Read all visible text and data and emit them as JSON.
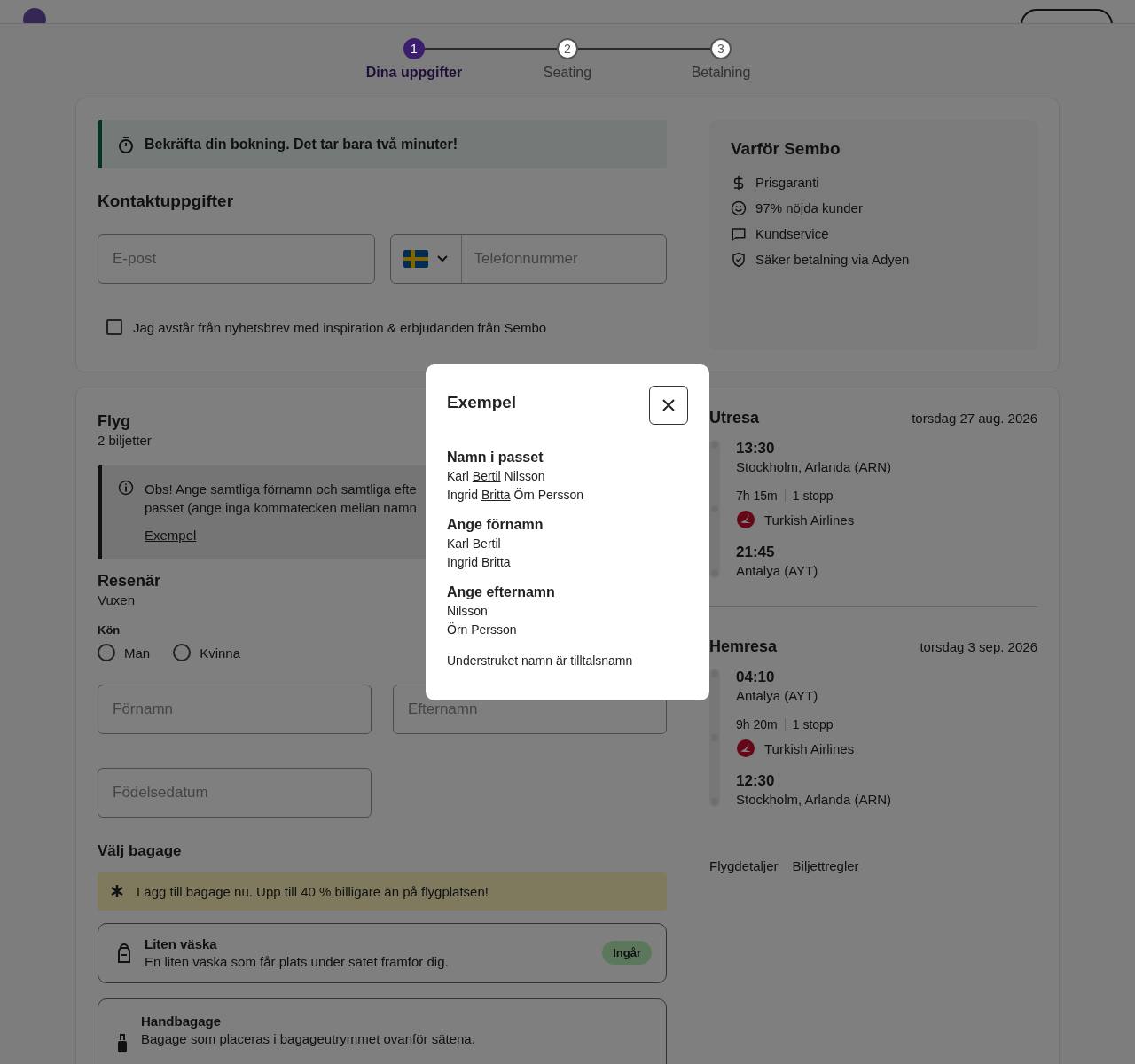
{
  "steps": [
    {
      "number": "1",
      "label": "Dina uppgifter",
      "selected": true
    },
    {
      "number": "2",
      "label": "Seating",
      "selected": false
    },
    {
      "number": "3",
      "label": "Betalning",
      "selected": false
    }
  ],
  "banner": {
    "text": "Bekräfta din bokning. Det tar bara två minuter!"
  },
  "contact": {
    "title": "Kontaktuppgifter",
    "email_placeholder": "E-post",
    "phone_placeholder": "Telefonnummer",
    "newsletter": {
      "label": "Jag avstår från nyhetsbrev med inspiration & erbjudanden från Sembo",
      "checked": false
    }
  },
  "why": {
    "title": "Varför Sembo",
    "items": [
      {
        "kind": "price",
        "text": "Prisgaranti"
      },
      {
        "kind": "smile",
        "text": "97% nöjda kunder"
      },
      {
        "kind": "chat",
        "text": "Kundservice"
      },
      {
        "kind": "shield",
        "text": "Säker betalning via Adyen"
      }
    ]
  },
  "flight": {
    "title": "Flyg",
    "subtitle": "2 biljetter",
    "notice": {
      "lines": [
        "Obs! Ange samtliga förnamn och samtliga efte",
        "passet (ange inga kommatecken mellan namn"
      ],
      "link": "Exempel"
    },
    "traveler": {
      "title": "Resenär",
      "subtitle": "Vuxen",
      "gender_label": "Kön",
      "options": [
        {
          "label": "Man",
          "selected": false
        },
        {
          "label": "Kvinna",
          "selected": false
        }
      ]
    },
    "first_name_placeholder": "Förnamn",
    "last_name_placeholder": "Efternamn",
    "birth_placeholder": "Födelsedatum",
    "baggage": {
      "title": "Välj bagage",
      "promo": "Lägg till bagage nu. Upp till 40 % billigare än på flygplatsen!",
      "items": [
        {
          "kind": "small",
          "title": "Liten väska",
          "description": "En liten väska som får plats under sätet framför dig.",
          "badge": "Ingår"
        },
        {
          "kind": "cabin",
          "title": "Handbagage",
          "description": "Bagage som placeras i bagageutrymmet ovanför sätena."
        }
      ]
    }
  },
  "trips": [
    {
      "title": "Utresa",
      "date": "torsdag 27 aug. 2026",
      "departure": {
        "time": "13:30",
        "place": "Stockholm, Arlanda (ARN)"
      },
      "duration": "7h 15m",
      "stops": "1 stopp",
      "airline": "Turkish Airlines",
      "arrival": {
        "time": "21:45",
        "place": "Antalya (AYT)"
      }
    },
    {
      "title": "Hemresa",
      "date": "torsdag 3 sep. 2026",
      "departure": {
        "time": "04:10",
        "place": "Antalya (AYT)"
      },
      "duration": "9h 20m",
      "stops": "1 stopp",
      "airline": "Turkish Airlines",
      "arrival": {
        "time": "12:30",
        "place": "Stockholm, Arlanda (ARN)"
      }
    }
  ],
  "trip_links": [
    "Flygdetaljer",
    "Biljettregler"
  ],
  "modal": {
    "title": "Exempel",
    "sections": [
      {
        "heading": "Namn i passet",
        "lines": [
          [
            {
              "text": "Karl ",
              "underlined": false
            },
            {
              "text": "Bertil",
              "underlined": true
            },
            {
              "text": " Nilsson",
              "underlined": false
            }
          ],
          [
            {
              "text": "Ingrid ",
              "underlined": false
            },
            {
              "text": "Britta",
              "underlined": true
            },
            {
              "text": " Örn Persson",
              "underlined": false
            }
          ]
        ]
      },
      {
        "heading": "Ange förnamn",
        "lines": [
          [
            {
              "text": "Karl Bertil",
              "underlined": false
            }
          ],
          [
            {
              "text": "Ingrid Britta",
              "underlined": false
            }
          ]
        ]
      },
      {
        "heading": "Ange efternamn",
        "lines": [
          [
            {
              "text": "Nilsson",
              "underlined": false
            }
          ],
          [
            {
              "text": "Örn Persson",
              "underlined": false
            }
          ]
        ]
      }
    ],
    "footnote": "Understruket namn är tilltalsnamn"
  }
}
